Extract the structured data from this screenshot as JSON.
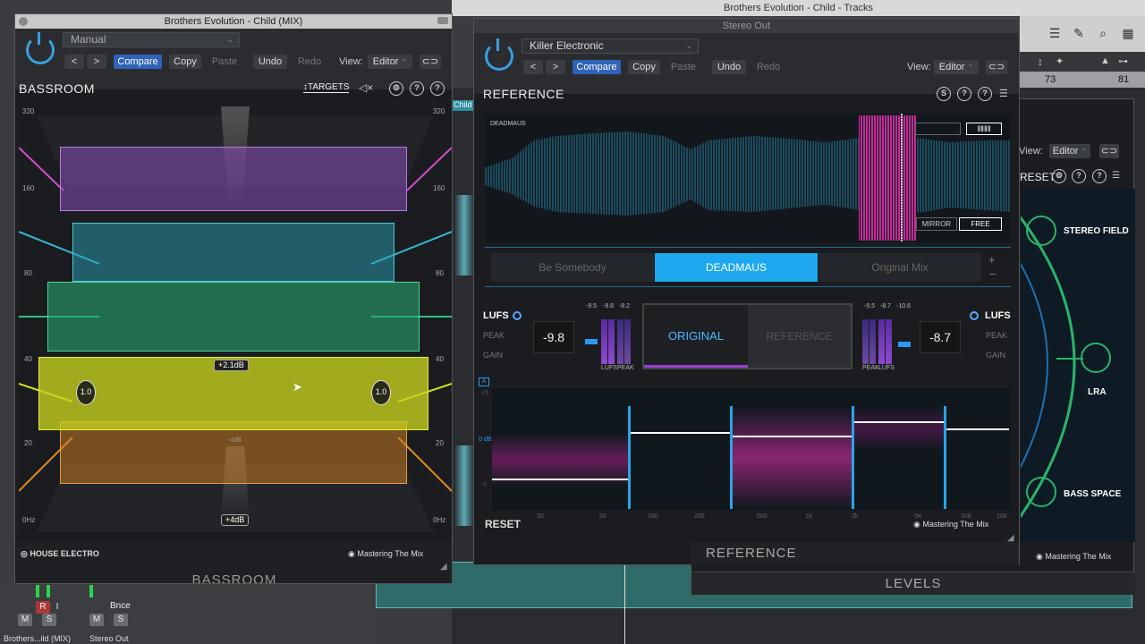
{
  "daw": {
    "title": "Brothers Evolution - Child - Tracks",
    "ruler": [
      "73",
      "81"
    ],
    "view_label": "View:",
    "view_value": "Editor",
    "track_label": "Child",
    "mixer": {
      "strip1_name": "Brothers...ild (MIX)",
      "strip2_name": "Stereo Out",
      "strip2_label": "Bnce",
      "mute": "M",
      "solo": "S",
      "rec": "R",
      "input": "I"
    }
  },
  "bassroom_window": {
    "title": "Brothers Evolution - Child (MIX)",
    "preset": "Manual",
    "buttons": {
      "back": "<",
      "forward": ">",
      "compare": "Compare",
      "copy": "Copy",
      "paste": "Paste",
      "undo": "Undo",
      "redo": "Redo"
    },
    "view_label": "View:",
    "view_value": "Editor",
    "plugin_name": "BASSROOM",
    "targets_label": "TARGETS",
    "scale_left": [
      "320",
      "160",
      "80",
      "40",
      "20",
      "0Hz"
    ],
    "scale_right": [
      "320",
      "160",
      "80",
      "40",
      "20",
      "0Hz"
    ],
    "gain_badge": "+2.1dB",
    "gain_zero": "-4dB",
    "gain_bottom": "+4dB",
    "q_left": "1.0",
    "q_right": "1.0",
    "genre_logo": "HOUSE ELECTRO",
    "brand": "Mastering The Mix",
    "footer_title": "BASSROOM"
  },
  "reference_window": {
    "window_title": "Stereo Out",
    "preset": "Killer Electronic",
    "buttons": {
      "back": "<",
      "forward": ">",
      "compare": "Compare",
      "copy": "Copy",
      "paste": "Paste",
      "undo": "Undo",
      "redo": "Redo"
    },
    "view_label": "View:",
    "view_value": "Editor",
    "plugin_name": "REFERENCE",
    "waveform_label": "DEADMAUS",
    "mirror_label": "MIRROR",
    "free_label": "FREE",
    "tabs": [
      "Be Somebody",
      "DEADMAUS",
      "Original Mix"
    ],
    "active_tab": 1,
    "plus": "+",
    "minus": "−",
    "left": {
      "lufs": "LUFS",
      "peak": "PEAK",
      "gain": "GAIN",
      "value": "-9.8",
      "meter_top": [
        "-9.5",
        "-9.8",
        "-8.2"
      ],
      "meter_bottom": [
        "LUFS",
        "PEAK"
      ]
    },
    "right": {
      "lufs": "LUFS",
      "peak": "PEAK",
      "gain": "GAIN",
      "value": "-8.7",
      "meter_top": [
        "-5.5",
        "-8.7",
        "-10.6"
      ],
      "meter_bottom": [
        "PEAK",
        "LUFS"
      ]
    },
    "toggle_original": "ORIGINAL",
    "toggle_reference": "REFERENCE",
    "eq_a": "A",
    "eq_plus": "+5",
    "eq_zero": "0 dB",
    "eq_minus": "-5",
    "eq_freqs": [
      "20",
      "50",
      "100",
      "200",
      "500",
      "1K",
      "2k",
      "5K",
      "10K",
      "20K"
    ],
    "reset": "RESET",
    "brand": "Mastering The Mix",
    "footer_title": "REFERENCE"
  },
  "levels_window": {
    "view_label": "View:",
    "view_value": "Editor",
    "reset_fragment": "RESET",
    "items": [
      "STEREO FIELD",
      "LRA",
      "BASS SPACE"
    ],
    "brand": "Mastering The Mix",
    "footer_title": "LEVELS"
  },
  "colors": {
    "accent_blue": "#1da8f0",
    "compare_blue": "#2f63b8",
    "purple": "#8a4fb8",
    "cyan": "#2a9fb5",
    "green": "#27a36e",
    "yellow": "#c9d21f",
    "orange": "#c77a22",
    "magenta": "#d12aa5"
  }
}
